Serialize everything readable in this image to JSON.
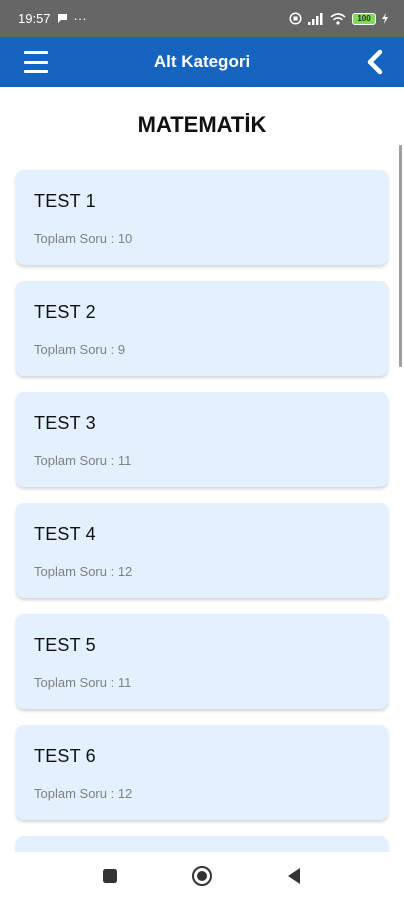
{
  "status_bar": {
    "time": "19:57",
    "extra": "···",
    "battery": "100"
  },
  "app_bar": {
    "title": "Alt Kategori"
  },
  "page": {
    "title": "MATEMATİK"
  },
  "tests": [
    {
      "title": "TEST 1",
      "count": "Toplam Soru : 10"
    },
    {
      "title": "TEST 2",
      "count": "Toplam Soru : 9"
    },
    {
      "title": "TEST 3",
      "count": "Toplam Soru : 11"
    },
    {
      "title": "TEST 4",
      "count": "Toplam Soru : 12"
    },
    {
      "title": "TEST 5",
      "count": "Toplam Soru : 11"
    },
    {
      "title": "TEST 6",
      "count": "Toplam Soru : 12"
    }
  ],
  "colors": {
    "app_bar": "#1565c0",
    "card_background": "#e3f0fd",
    "status_bar": "#666666"
  },
  "icons": {
    "menu": "hamburger-icon",
    "back": "chevron-left-icon",
    "nav_recents": "square-icon",
    "nav_home": "circle-icon",
    "nav_back": "triangle-back-icon"
  }
}
